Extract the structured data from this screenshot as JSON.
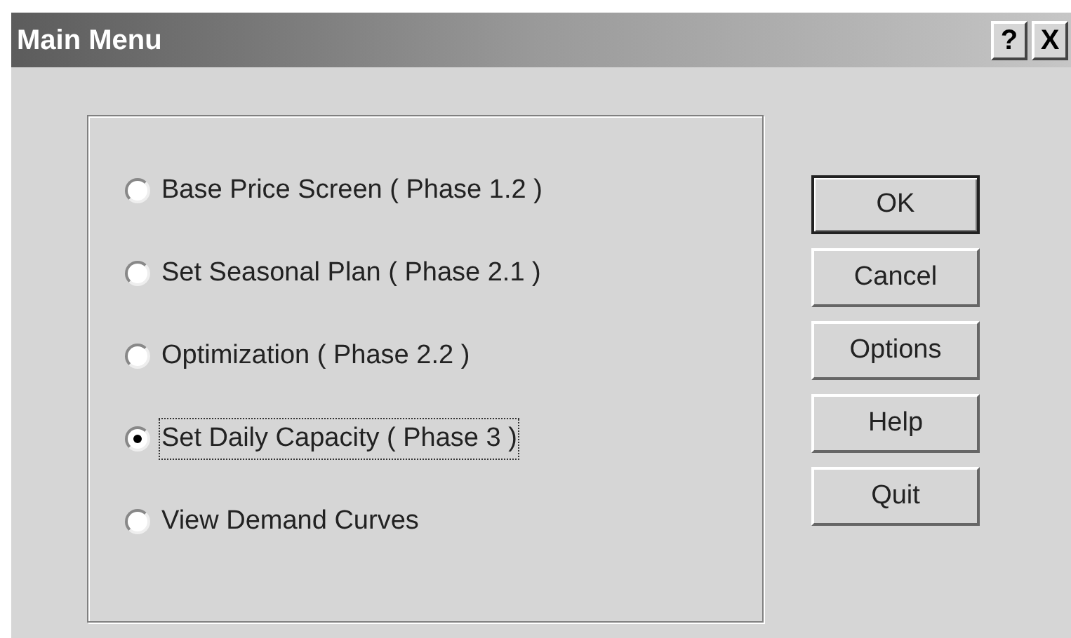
{
  "window": {
    "title": "Main Menu",
    "title_buttons": [
      "?",
      "X"
    ]
  },
  "options": [
    {
      "label": "Base Price Screen ( Phase 1.2 )",
      "selected": false
    },
    {
      "label": "Set Seasonal Plan ( Phase 2.1 )",
      "selected": false
    },
    {
      "label": "Optimization ( Phase 2.2 )",
      "selected": false
    },
    {
      "label": "Set Daily Capacity ( Phase 3 )",
      "selected": true
    },
    {
      "label": "View Demand Curves",
      "selected": false
    }
  ],
  "buttons": [
    {
      "label": "OK",
      "default": true
    },
    {
      "label": "Cancel",
      "default": false
    },
    {
      "label": "Options",
      "default": false
    },
    {
      "label": "Help",
      "default": false
    },
    {
      "label": "Quit",
      "default": false
    }
  ]
}
